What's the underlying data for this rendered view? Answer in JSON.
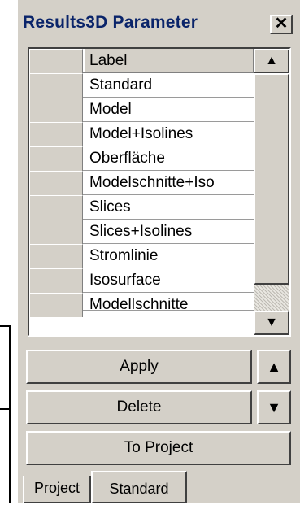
{
  "window": {
    "title": "Results3D Parameter",
    "close_glyph": "✕"
  },
  "grid": {
    "column_header": "Label",
    "rows": [
      "Standard",
      "Model",
      "Model+Isolines",
      "Oberfläche",
      "Modelschnitte+Iso",
      "Slices",
      "Slices+Isolines",
      "Stromlinie",
      "Isosurface",
      "Modellschnitte"
    ]
  },
  "scrollbar": {
    "up_glyph": "▲",
    "down_glyph": "▼"
  },
  "buttons": {
    "apply": "Apply",
    "delete": "Delete",
    "to_project": "To Project",
    "move_up": "▲",
    "move_down": "▼"
  },
  "tabs": {
    "project": "Project",
    "standard": "Standard",
    "active": "Standard"
  }
}
